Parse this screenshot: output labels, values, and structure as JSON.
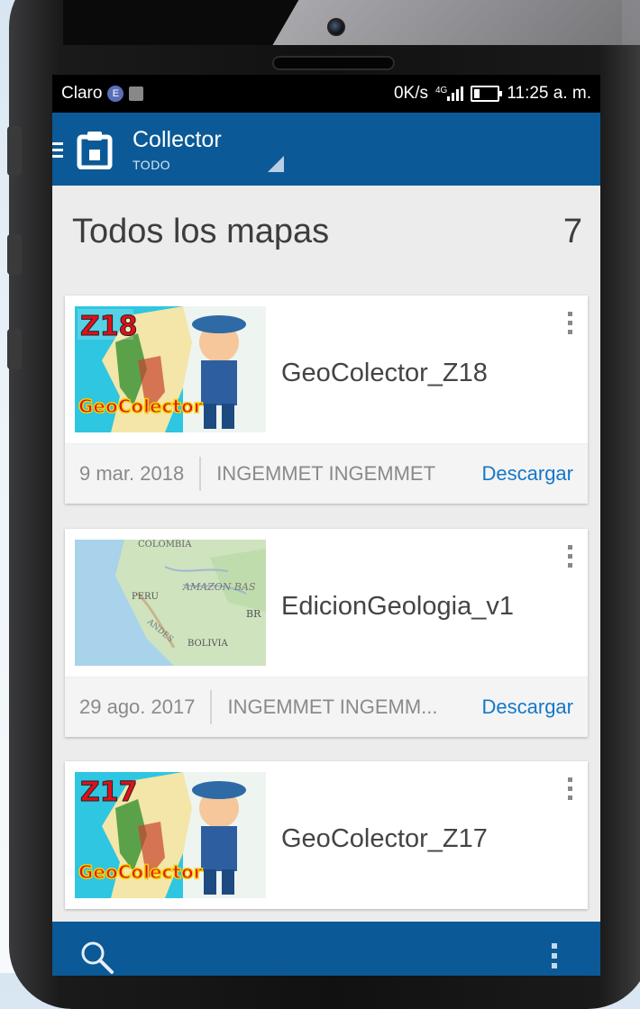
{
  "status": {
    "carrier": "Claro",
    "notif_e": "E",
    "speed": "0K/s",
    "network": "4G",
    "time": "11:25 a. m."
  },
  "appbar": {
    "title": "Collector",
    "subtitle": "TODO"
  },
  "main": {
    "heading": "Todos los mapas",
    "count": "7"
  },
  "maps": [
    {
      "name": "GeoColector_Z18",
      "date": "9 mar. 2018",
      "owner": "INGEMMET INGEMMET",
      "action": "Descargar",
      "thumb_badge": "Z18",
      "thumb_caption": "GeoColector"
    },
    {
      "name": "EdicionGeologia_v1",
      "date": "29 ago. 2017",
      "owner": "INGEMMET INGEMM...",
      "action": "Descargar",
      "thumb_labels": [
        "COLOMBIA",
        "AMAZON BAS",
        "PERU",
        "BR",
        "BOLIVIA",
        "ANDES"
      ]
    },
    {
      "name": "GeoColector_Z17",
      "thumb_badge": "Z17",
      "thumb_caption": "GeoColector"
    }
  ],
  "colors": {
    "appbar": "#0b5a97",
    "link": "#1478c8",
    "badge_red": "#e0101a"
  },
  "icons": {
    "menu": "hamburger-icon",
    "app": "clipboard-icon",
    "search": "search-icon",
    "overflow": "more-vert-icon"
  }
}
